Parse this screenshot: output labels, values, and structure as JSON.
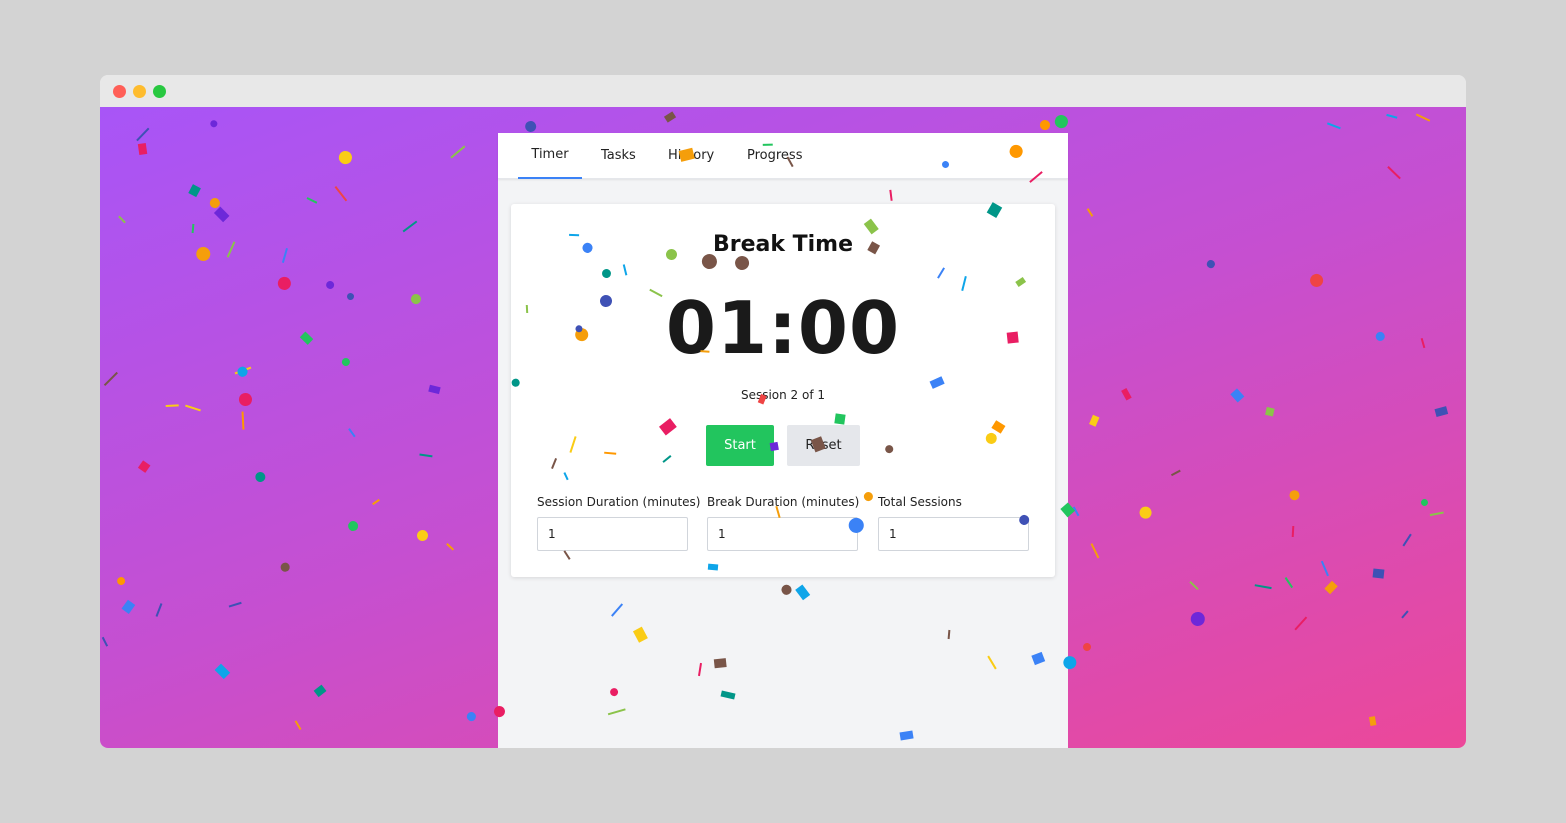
{
  "tabs": {
    "timer": "Timer",
    "tasks": "Tasks",
    "history": "History",
    "progress": "Progress"
  },
  "timer_card": {
    "title": "Break Time",
    "time": "01:00",
    "session_text": "Session 2 of 1",
    "start_label": "Start",
    "reset_label": "Reset"
  },
  "settings": {
    "session_duration_label": "Session Duration (minutes)",
    "session_duration_value": "1",
    "break_duration_label": "Break Duration (minutes)",
    "break_duration_value": "1",
    "total_sessions_label": "Total Sessions",
    "total_sessions_value": "1"
  },
  "colors": {
    "background_gradient_start": "#a855f7",
    "background_gradient_end": "#ec4899",
    "start_button": "#22c55e",
    "reset_button": "#e5e7eb",
    "active_tab_underline": "#3b82f6"
  }
}
